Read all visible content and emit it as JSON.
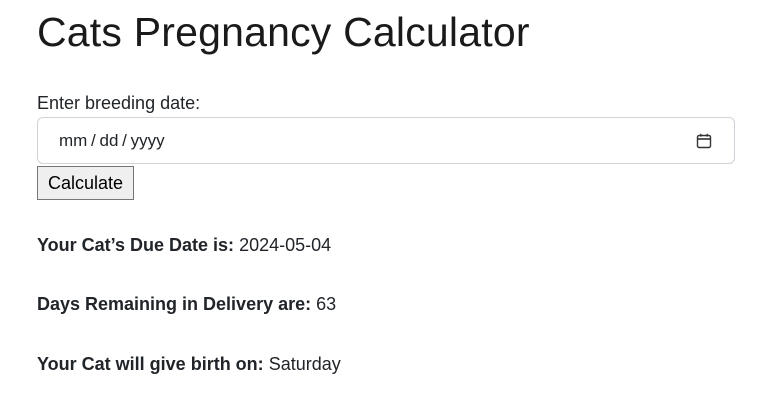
{
  "page": {
    "title": "Cats Pregnancy Calculator"
  },
  "form": {
    "date_label": "Enter breeding date:",
    "date_placeholder": "mm / dd / yyyy",
    "calculate_label": "Calculate"
  },
  "results": {
    "due_date_label": "Your Cat’s Due Date is:",
    "due_date_value": "2024-05-04",
    "days_remaining_label": "Days Remaining in Delivery are:",
    "days_remaining_value": "63",
    "birth_day_label": "Your Cat will give birth on:",
    "birth_day_value": "Saturday"
  },
  "icons": {
    "date_picker": "calendar-icon"
  },
  "colors": {
    "text": "#212529",
    "input_border": "#ced4da",
    "button_bg": "#efefef",
    "button_border": "#767676"
  }
}
